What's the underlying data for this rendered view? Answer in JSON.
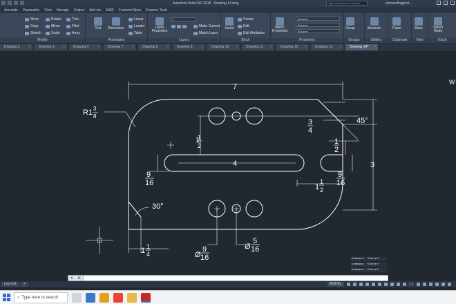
{
  "app": {
    "title": "Autodesk AutoCAD 2018",
    "document": "Drawing 14.dwg",
    "search_placeholder": "Type a keyword or phrase",
    "user": "ahmeedfugyhal..."
  },
  "menu_tabs": [
    "Annotate",
    "Parametric",
    "View",
    "Manage",
    "Output",
    "Add-ins",
    "A360",
    "Featured Apps",
    "Express Tools"
  ],
  "ribbon": {
    "modify": {
      "label": "Modify",
      "tools": [
        "Move",
        "Rotate",
        "Trim",
        "Copy",
        "Mirror",
        "Fillet",
        "Stretch",
        "Scale",
        "Array"
      ]
    },
    "annotation": {
      "label": "Annotation",
      "tools": [
        "Linear",
        "Leader",
        "Table"
      ],
      "big": [
        "Text",
        "Dimension"
      ]
    },
    "layers": {
      "label": "Layers",
      "big": "Layer Properties",
      "tools": [
        "Make Current",
        "Match Layer"
      ],
      "current_layer": "0"
    },
    "block": {
      "label": "Block",
      "big": "Insert",
      "tools": [
        "Create",
        "Edit",
        "Edit Attributes"
      ]
    },
    "properties": {
      "label": "Properties",
      "big": "Match Properties",
      "color": "ByLayer",
      "linetype": "ByLayer",
      "lineweight": "ByLayer"
    },
    "groups": {
      "label": "Groups",
      "big": "Group"
    },
    "utilities": {
      "label": "Utilities",
      "big": "Measure"
    },
    "clipboard": {
      "label": "Clipboard",
      "big": "Paste"
    },
    "view": {
      "label": "View",
      "big": "Base"
    },
    "touch": {
      "label": "Touch",
      "big": "Select Mode"
    }
  },
  "doc_tabs": [
    "Drawing 2",
    "Drawing 3",
    "Drawing 4",
    "Drawing 7",
    "Drawing 5",
    "Drawing 8",
    "Drawing 10",
    "Drawing 11",
    "Drawing 12",
    "Drawing 13",
    "Drawing 14*"
  ],
  "drawing": {
    "dims": {
      "overall_width": "7",
      "height": "3",
      "slot_length": "4",
      "angle_top": "45°",
      "angle_bottom": "30°",
      "radius_prefix": "R1",
      "radius_num": "3",
      "radius_den": "8",
      "left_offset_whole": "1",
      "left_offset_num": "1",
      "left_offset_den": "4",
      "slot_half_whole": "1",
      "slot_half_num": "1",
      "slot_half_den": "2",
      "right_half_num": "1",
      "right_half_den": "2",
      "slot_width_num": "9",
      "slot_width_den": "16",
      "right_slot_num": "9",
      "right_slot_den": "16",
      "chamfer_num": "3",
      "chamfer_den": "4",
      "bottom_right_whole": "1",
      "bottom_right_num": "1",
      "bottom_right_den": "2",
      "hole_large_prefix": "Ø",
      "hole_large_num": "9",
      "hole_large_den": "16",
      "hole_small_prefix": "Ø",
      "hole_small_num": "5",
      "hole_small_den": "16"
    }
  },
  "command_history": [
    "Command: *Cancel*",
    "Command: *Cancel*",
    "Command: *Cancel*"
  ],
  "command_prompt": "",
  "layout_tabs": [
    "Layout1"
  ],
  "status": {
    "mode": "MODEL",
    "scale": "1:1"
  },
  "taskbar": {
    "search_text": "Type here to search"
  },
  "colors": {
    "canvas": "#212830",
    "geometry": "#ffffff",
    "ribbon": "#3b4658",
    "accent": "#3a78c9"
  }
}
